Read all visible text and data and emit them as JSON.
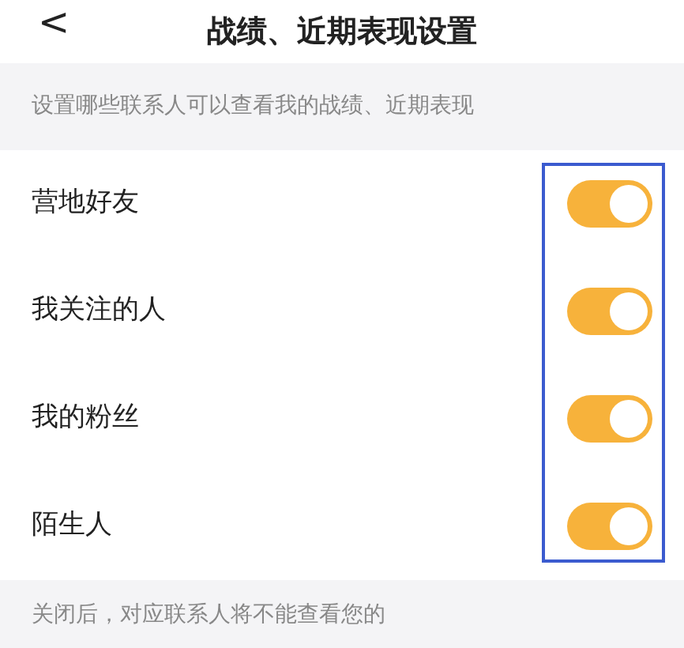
{
  "header": {
    "back": "<",
    "title": "战绩、近期表现设置"
  },
  "description": "设置哪些联系人可以查看我的战绩、近期表现",
  "settings": [
    {
      "label": "营地好友",
      "on": true
    },
    {
      "label": "我关注的人",
      "on": true
    },
    {
      "label": "我的粉丝",
      "on": true
    },
    {
      "label": "陌生人",
      "on": true
    }
  ],
  "footer_note": "关闭后，对应联系人将不能查看您的"
}
